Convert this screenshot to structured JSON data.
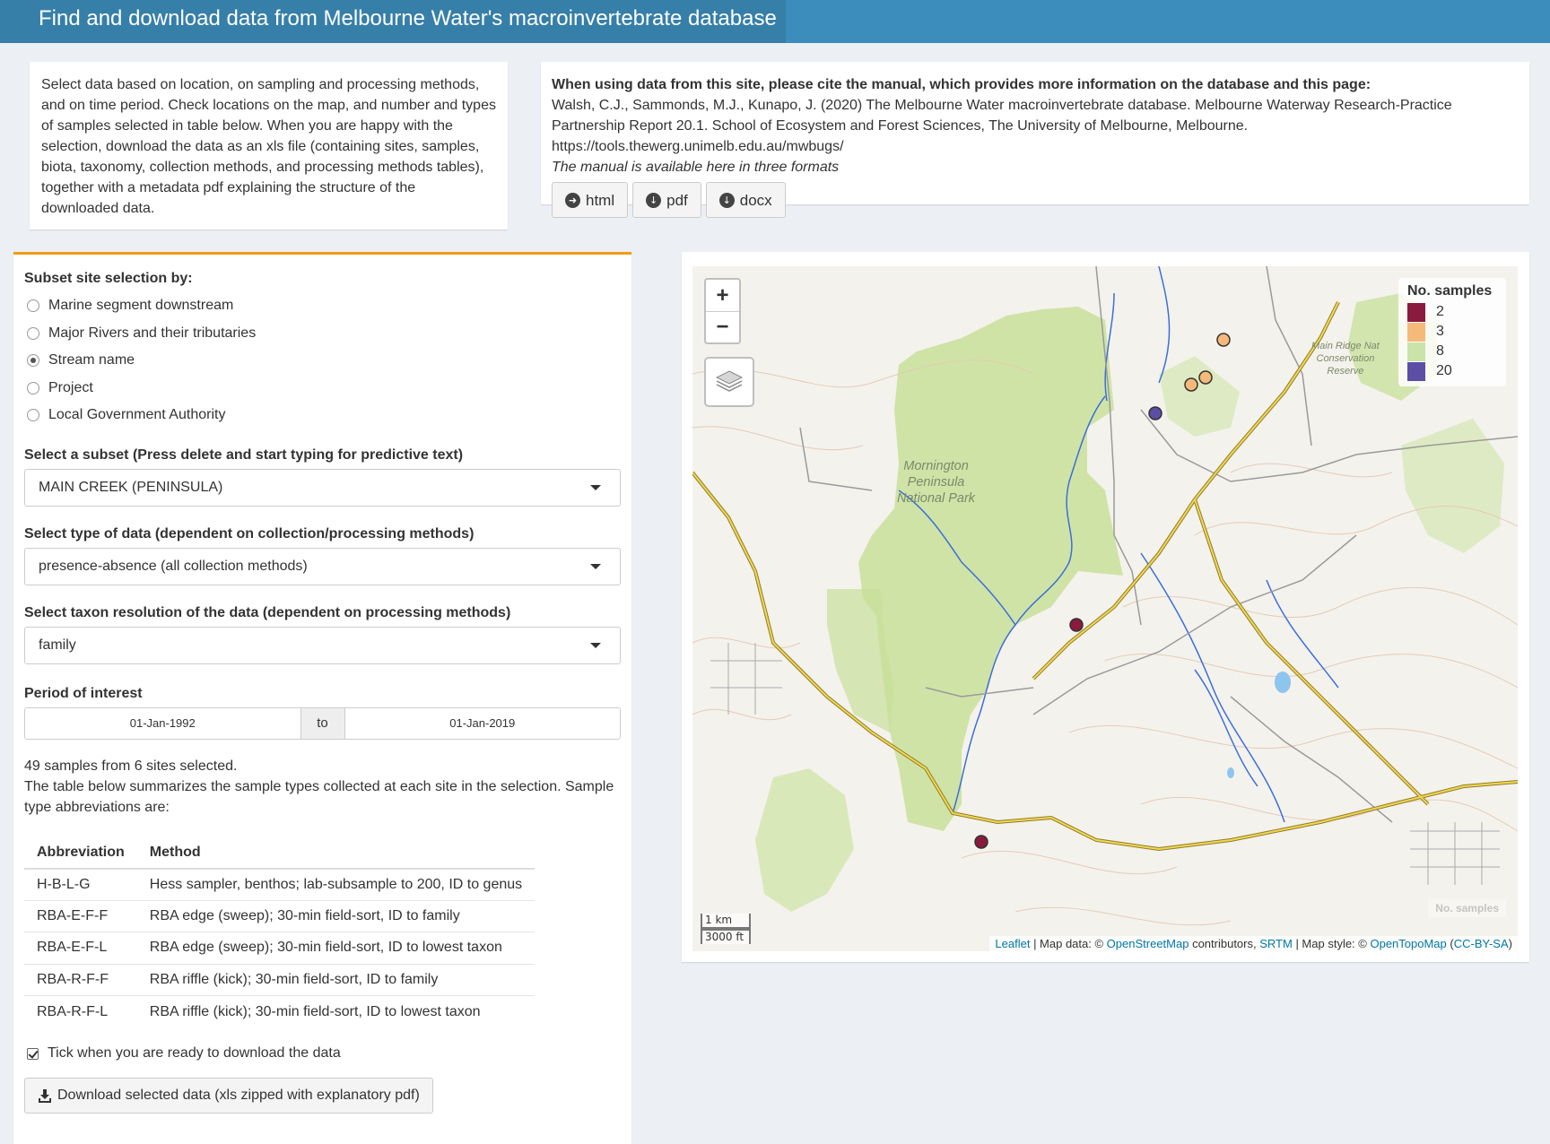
{
  "header": {
    "title": "Find and download data from Melbourne Water's macroinvertebrate database"
  },
  "intro": {
    "text": "Select data based on location, on sampling and processing methods, and on time period. Check locations on the map, and number and types of samples selected in table below. When you are happy with the selection, download the data as an xls file (containing sites, samples, biota, taxonomy, collection methods, and processing methods tables), together with a metadata pdf explaining the structure of the downloaded data."
  },
  "citation": {
    "heading": "When using data from this site, please cite the manual, which provides more information on the database and this page:",
    "reference": "Walsh, C.J., Sammonds, M.J., Kunapo, J. (2020) The Melbourne Water macroinvertebrate database. Melbourne Waterway Research-Practice Partnership Report 20.1. School of Ecosystem and Forest Sciences, The University of Melbourne, Melbourne. https://tools.thewerg.unimelb.edu.au/mwbugs/",
    "formats_note": "The manual is available here in three formats",
    "buttons": [
      {
        "label": "html",
        "icon": "circle-arrow-right-icon"
      },
      {
        "label": "pdf",
        "icon": "circle-arrow-down-icon"
      },
      {
        "label": "docx",
        "icon": "circle-arrow-down-icon"
      }
    ]
  },
  "filters": {
    "subset_label": "Subset site selection by:",
    "subset_options": [
      "Marine segment downstream",
      "Major Rivers and their tributaries",
      "Stream name",
      "Project",
      "Local Government Authority"
    ],
    "subset_selected": "Stream name",
    "select_subset_label": "Select a subset (Press delete and start typing for predictive text)",
    "select_subset_value": "MAIN CREEK (PENINSULA)",
    "data_type_label": "Select type of data (dependent on collection/processing methods)",
    "data_type_value": "presence-absence (all collection methods)",
    "taxon_label": "Select taxon resolution of the data (dependent on processing methods)",
    "taxon_value": "family",
    "period_label": "Period of interest",
    "period_start": "01-Jan-1992",
    "period_to": "to",
    "period_end": "01-Jan-2019"
  },
  "summary": {
    "line1": "49 samples from 6 sites selected.",
    "line2": "The table below summarizes the sample types collected at each site in the selection. Sample type abbreviations are:"
  },
  "abbreviations": {
    "headers": [
      "Abbreviation",
      "Method"
    ],
    "rows": [
      [
        "H-B-L-G",
        "Hess sampler, benthos; lab-subsample to 200, ID to genus"
      ],
      [
        "RBA-E-F-F",
        "RBA edge (sweep); 30-min field-sort, ID to family"
      ],
      [
        "RBA-E-F-L",
        "RBA edge (sweep); 30-min field-sort, ID to lowest taxon"
      ],
      [
        "RBA-R-F-F",
        "RBA riffle (kick); 30-min field-sort, ID to family"
      ],
      [
        "RBA-R-F-L",
        "RBA riffle (kick); 30-min field-sort, ID to lowest taxon"
      ]
    ]
  },
  "download": {
    "tick_label": "Tick when you are ready to download the data",
    "tick_checked": true,
    "button_label": "Download selected data (xls zipped with explanatory pdf)"
  },
  "map": {
    "zoom_in": "+",
    "zoom_out": "−",
    "park_label": [
      "Mornington",
      "Peninsula",
      "National Park"
    ],
    "reserve_label": [
      "Main Ridge Nat",
      "Conservation",
      "Reserve"
    ],
    "legend": {
      "title": "No. samples",
      "items": [
        {
          "value": "2",
          "color": "#8b1a3f"
        },
        {
          "value": "3",
          "color": "#f5b97a"
        },
        {
          "value": "8",
          "color": "#c9e3a8"
        },
        {
          "value": "20",
          "color": "#5b4ea4"
        }
      ]
    },
    "sites": [
      {
        "samples": 20,
        "color": "#5b4ea4"
      },
      {
        "samples": 3,
        "color": "#f5b97a"
      },
      {
        "samples": 3,
        "color": "#f5b97a"
      },
      {
        "samples": 3,
        "color": "#f5b97a"
      },
      {
        "samples": 2,
        "color": "#8b1a3f"
      },
      {
        "samples": 2,
        "color": "#8b1a3f"
      }
    ],
    "scale_km": "1 km",
    "scale_ft": "3000 ft",
    "ghost_legend": "No. samples",
    "attribution": {
      "leaflet": "Leaflet",
      "sep1": " | Map data: © ",
      "osm": "OpenStreetMap",
      "contrib": " contributors, ",
      "srtm": "SRTM",
      "sep2": " | Map style: © ",
      "otm": "OpenTopoMap",
      "open": " (",
      "license": "CC-BY-SA",
      "close": ")"
    }
  }
}
